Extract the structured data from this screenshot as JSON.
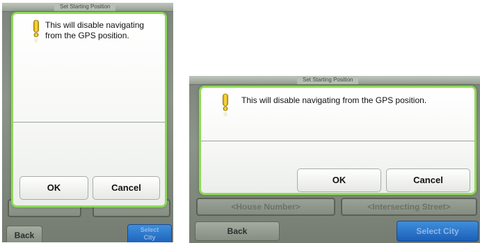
{
  "dialog": {
    "message": "This will disable navigating from the GPS position.",
    "ok_label": "OK",
    "cancel_label": "Cancel",
    "warning_icon": "exclamation-warning-icon",
    "border_color": "#8fd85a"
  },
  "screen": {
    "title": "Set Starting Position",
    "house_number_placeholder": "<House Number>",
    "intersecting_street_placeholder": "<Intersecting Street>",
    "back_label": "Back",
    "select_city_label": "Select City",
    "select_city_label_short_line1": "Select",
    "select_city_label_short_line2": "City",
    "accent_color": "#1b5fb8"
  }
}
